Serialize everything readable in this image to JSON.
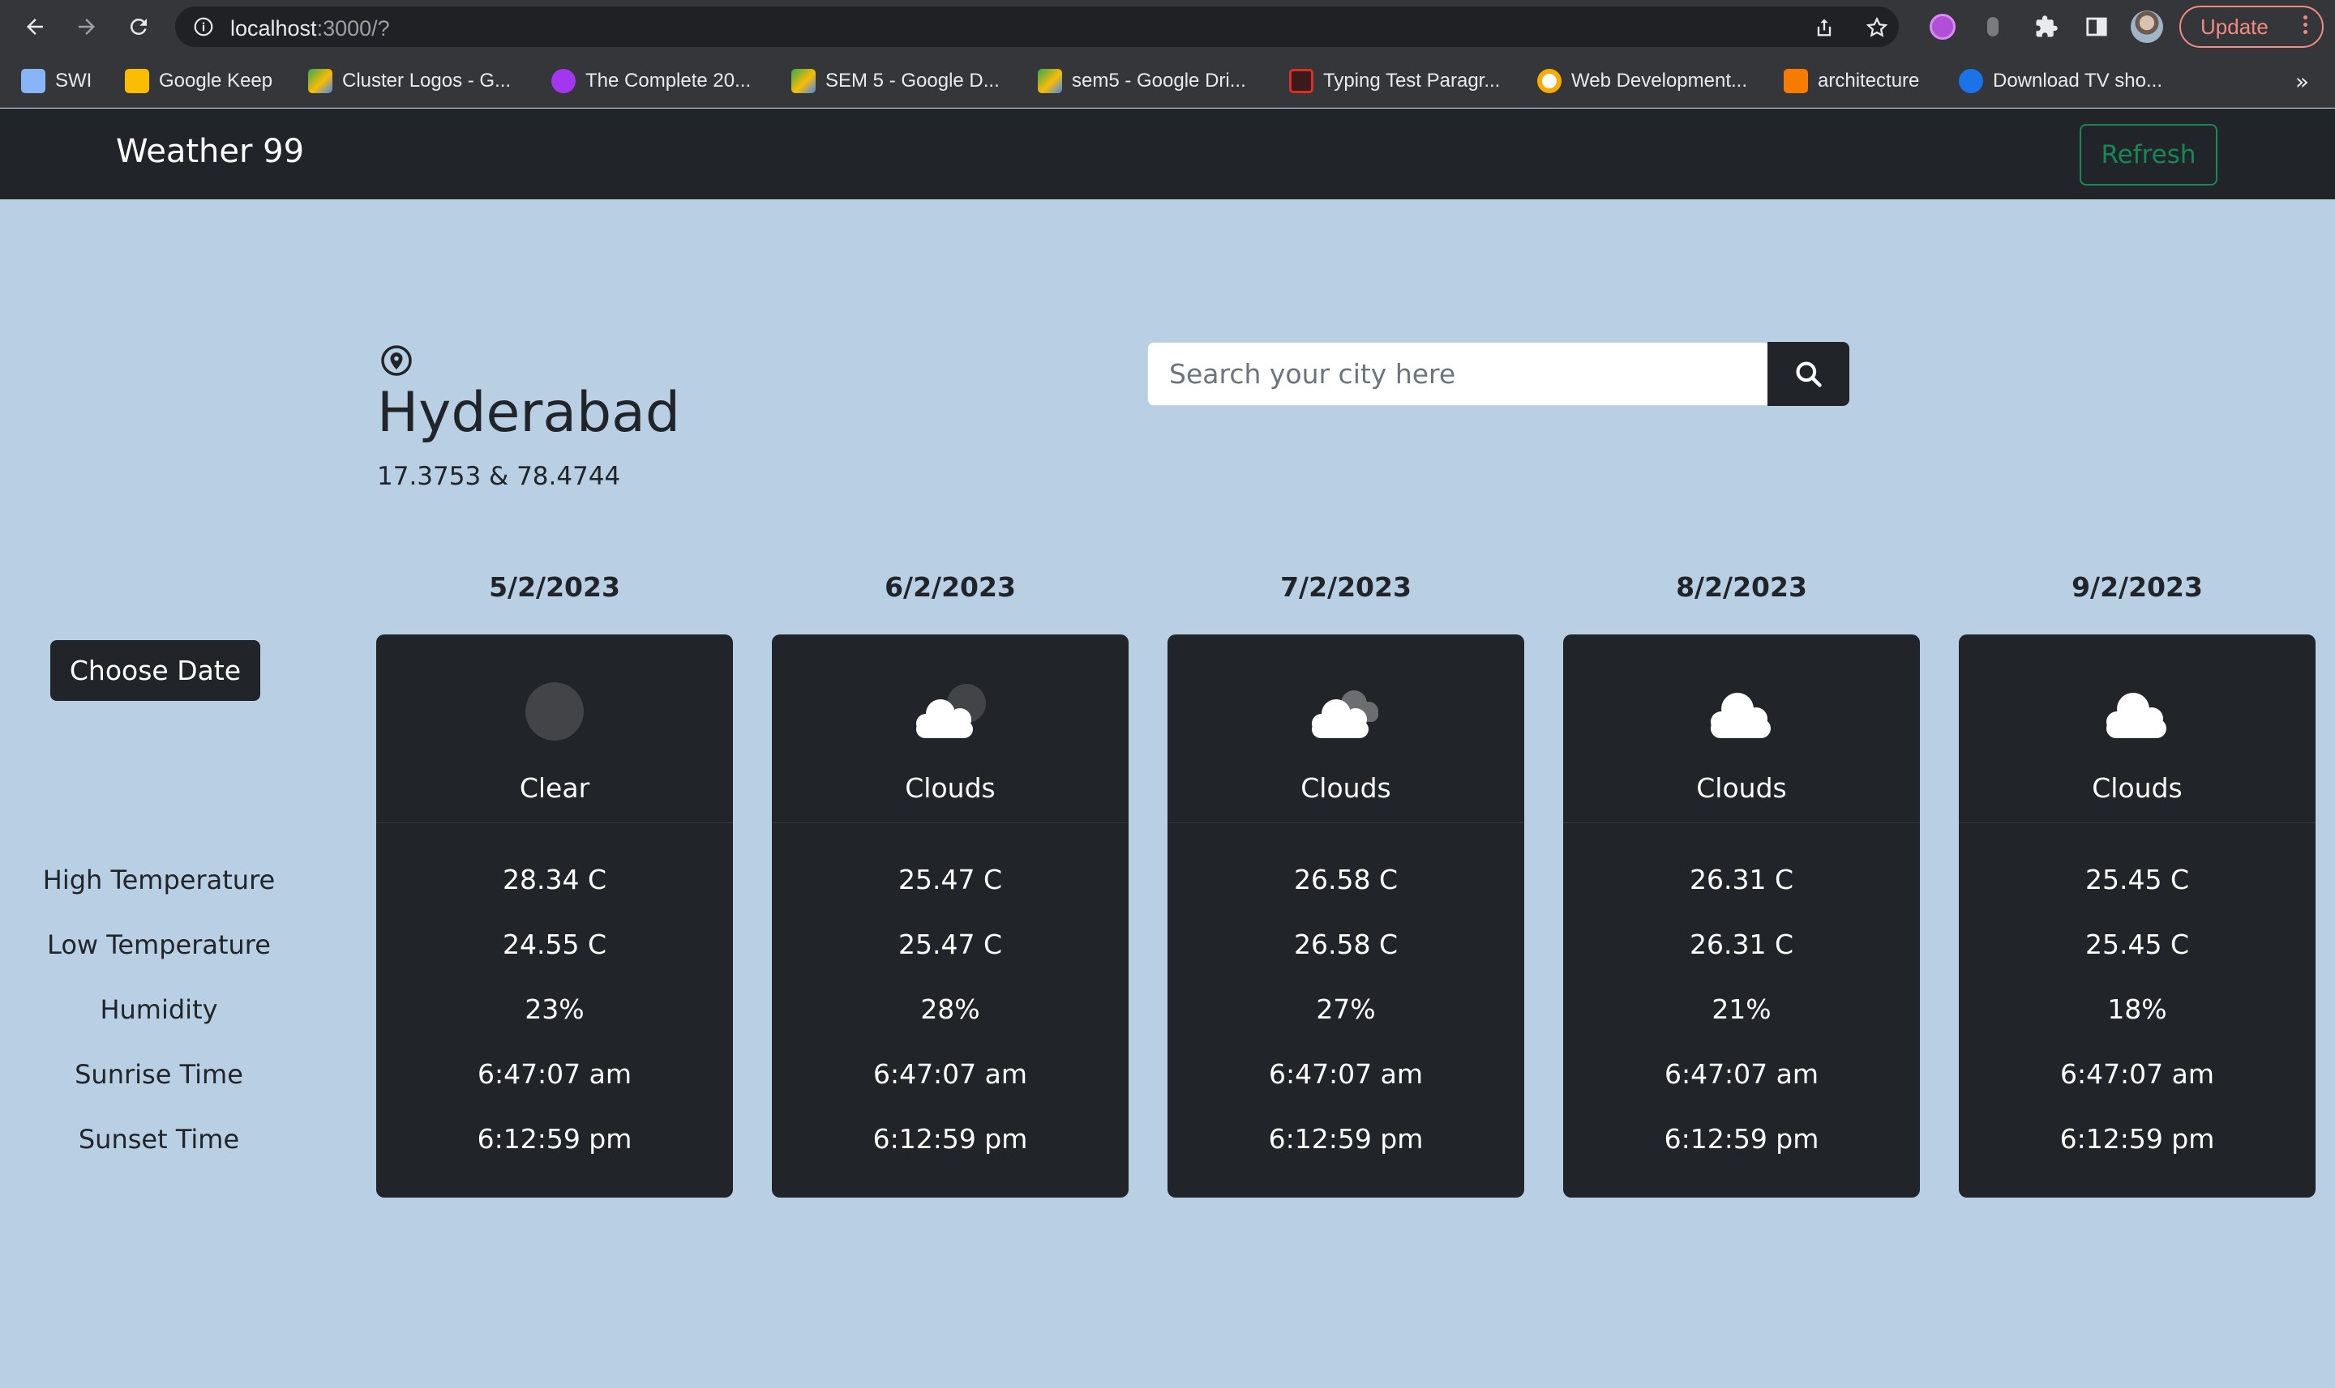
{
  "browser": {
    "url_host": "localhost",
    "url_rest": ":3000/?",
    "update_label": "Update",
    "bookmarks": [
      {
        "label": "SWI",
        "icon": "swi-icon",
        "color": "#8ab4f8"
      },
      {
        "label": "Google Keep",
        "icon": "google-keep-icon",
        "color": "#fbbc04"
      },
      {
        "label": "Cluster Logos - G...",
        "icon": "google-drive-icon",
        "color": "#34a853"
      },
      {
        "label": "The Complete 20...",
        "icon": "udemy-icon",
        "color": "#a435f0"
      },
      {
        "label": "SEM 5 - Google D...",
        "icon": "google-drive-icon",
        "color": "#34a853"
      },
      {
        "label": "sem5 - Google Dri...",
        "icon": "google-drive-icon",
        "color": "#34a853"
      },
      {
        "label": "Typing Test Paragr...",
        "icon": "typing-test-icon",
        "color": "#d93025"
      },
      {
        "label": "Web Development...",
        "icon": "web-dev-icon",
        "color": "#f9ab00"
      },
      {
        "label": "architecture",
        "icon": "architecture-icon",
        "color": "#f57c00"
      },
      {
        "label": "Download TV sho...",
        "icon": "tv-icon",
        "color": "#1a73e8"
      }
    ]
  },
  "app": {
    "brand": "Weather 99",
    "refresh_label": "Refresh",
    "colors": {
      "background": "#b9d0e4",
      "dark": "#212529",
      "success": "#198754"
    }
  },
  "location": {
    "city": "Hyderabad",
    "coords": "17.3753 & 78.4744"
  },
  "search": {
    "placeholder": "Search your city here"
  },
  "choose_date_label": "Choose Date",
  "row_labels": [
    "High Temperature",
    "Low Temperature",
    "Humidity",
    "Sunrise Time",
    "Sunset Time"
  ],
  "forecast": [
    {
      "date": "5/2/2023",
      "condition": "Clear",
      "icon": "clear-moon-icon",
      "high": "28.34 C",
      "low": "24.55 C",
      "humidity": "23%",
      "sunrise": "6:47:07 am",
      "sunset": "6:12:59 pm"
    },
    {
      "date": "6/2/2023",
      "condition": "Clouds",
      "icon": "few-clouds-night-icon",
      "high": "25.47 C",
      "low": "25.47 C",
      "humidity": "28%",
      "sunrise": "6:47:07 am",
      "sunset": "6:12:59 pm"
    },
    {
      "date": "7/2/2023",
      "condition": "Clouds",
      "icon": "broken-clouds-icon",
      "high": "26.58 C",
      "low": "26.58 C",
      "humidity": "27%",
      "sunrise": "6:47:07 am",
      "sunset": "6:12:59 pm"
    },
    {
      "date": "8/2/2023",
      "condition": "Clouds",
      "icon": "cloud-icon",
      "high": "26.31 C",
      "low": "26.31 C",
      "humidity": "21%",
      "sunrise": "6:47:07 am",
      "sunset": "6:12:59 pm"
    },
    {
      "date": "9/2/2023",
      "condition": "Clouds",
      "icon": "cloud-icon",
      "high": "25.45 C",
      "low": "25.45 C",
      "humidity": "18%",
      "sunrise": "6:47:07 am",
      "sunset": "6:12:59 pm"
    }
  ]
}
